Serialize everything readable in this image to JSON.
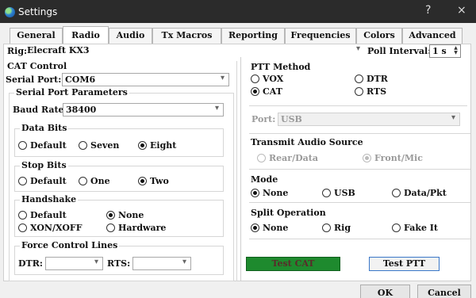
{
  "window": {
    "title": "Settings",
    "help_glyph": "?",
    "close_glyph": "×"
  },
  "tabs": [
    {
      "label": "General",
      "active": false
    },
    {
      "label": "Radio",
      "active": true
    },
    {
      "label": "Audio",
      "active": false
    },
    {
      "label": "Tx Macros",
      "active": false
    },
    {
      "label": "Reporting",
      "active": false
    },
    {
      "label": "Frequencies",
      "active": false
    },
    {
      "label": "Colors",
      "active": false
    },
    {
      "label": "Advanced",
      "active": false
    }
  ],
  "rig": {
    "label": "Rig:",
    "value": "Elecraft KX3",
    "poll_label": "Poll Interval:",
    "poll_value": "1 s"
  },
  "cat_control": {
    "title": "CAT Control",
    "serial_port_label": "Serial Port:",
    "serial_port_value": "COM6",
    "params_title": "Serial Port Parameters",
    "baud_label": "Baud Rate:",
    "baud_value": "38400",
    "data_bits": {
      "title": "Data Bits",
      "options": [
        "Default",
        "Seven",
        "Eight"
      ],
      "selected": "Eight"
    },
    "stop_bits": {
      "title": "Stop Bits",
      "options": [
        "Default",
        "One",
        "Two"
      ],
      "selected": "Two"
    },
    "handshake": {
      "title": "Handshake",
      "options": [
        "Default",
        "None",
        "XON/XOFF",
        "Hardware"
      ],
      "selected": "None"
    },
    "force_control": {
      "title": "Force Control Lines",
      "dtr_label": "DTR:",
      "dtr_value": "",
      "rts_label": "RTS:",
      "rts_value": ""
    }
  },
  "ptt_method": {
    "title": "PTT Method",
    "options": [
      "VOX",
      "DTR",
      "CAT",
      "RTS"
    ],
    "selected": "CAT",
    "port_label": "Port:",
    "port_value": "USB"
  },
  "transmit_audio_source": {
    "title": "Transmit Audio Source",
    "options": [
      "Rear/Data",
      "Front/Mic"
    ],
    "selected": "Front/Mic"
  },
  "mode": {
    "title": "Mode",
    "options": [
      "None",
      "USB",
      "Data/Pkt"
    ],
    "selected": "None"
  },
  "split_operation": {
    "title": "Split Operation",
    "options": [
      "None",
      "Rig",
      "Fake It"
    ],
    "selected": "None"
  },
  "buttons": {
    "test_cat": "Test CAT",
    "test_ptt": "Test PTT",
    "ok": "OK",
    "cancel": "Cancel"
  },
  "colors": {
    "titlebar": "#2b2b2b",
    "test_cat_bg": "#1e8a2e",
    "test_ptt_border": "#3a77c8"
  },
  "icons": {
    "dropdown": "▾",
    "spin_up": "▲",
    "spin_down": "▼",
    "app": "settings-app-icon"
  }
}
